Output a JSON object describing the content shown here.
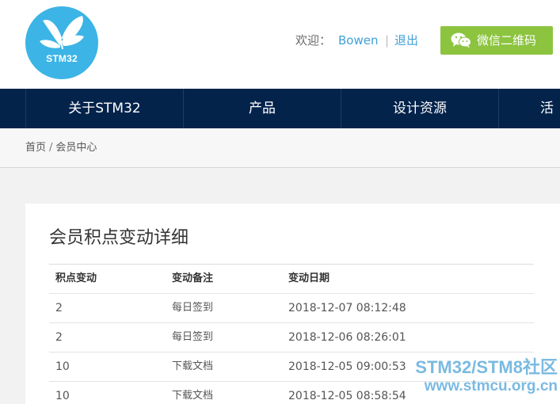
{
  "header": {
    "logo_text": "STM32",
    "welcome_label": "欢迎：",
    "username": "Bowen",
    "separator": "|",
    "logout_label": "退出",
    "wechat_button_label": "微信二维码",
    "wechat_icon": "wechat-icon"
  },
  "nav": {
    "items": [
      "关于STM32",
      "产品",
      "设计资源",
      "活动"
    ]
  },
  "breadcrumb": {
    "home": "首页",
    "separator": "/",
    "current": "会员中心"
  },
  "points": {
    "title": "会员积点变动详细",
    "columns": [
      "积点变动",
      "变动备注",
      "变动日期"
    ],
    "rows": [
      [
        "2",
        "每日签到",
        "2018-12-07 08:12:48"
      ],
      [
        "2",
        "每日签到",
        "2018-12-06 08:26:01"
      ],
      [
        "10",
        "下载文档",
        "2018-12-05 09:00:53"
      ],
      [
        "10",
        "下载文档",
        "2018-12-05 08:58:54"
      ]
    ]
  },
  "watermark": {
    "line1": "STM32/STM8社区",
    "line2": "www.stmcu.org.cn"
  },
  "colors": {
    "nav_bg": "#03234b",
    "logo_bg": "#3cb4e5",
    "link": "#3fa0d8",
    "wechat_button": "#8cc43f"
  }
}
